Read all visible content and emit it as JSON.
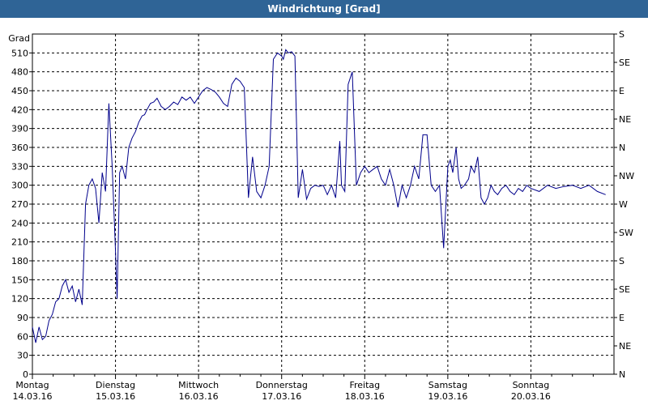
{
  "window": {
    "title": "Windrichtung [Grad]"
  },
  "chart_data": {
    "type": "line",
    "title": "Windrichtung [Grad]",
    "ylabel": "Grad",
    "ylim": [
      0,
      540
    ],
    "yticks": [
      0,
      30,
      60,
      90,
      120,
      150,
      180,
      210,
      240,
      270,
      300,
      330,
      360,
      390,
      420,
      450,
      480,
      510
    ],
    "right_axis_labels": [
      "N",
      "NE",
      "E",
      "SE",
      "S",
      "SW",
      "W",
      "NW",
      "N",
      "NE",
      "E",
      "SE",
      "S"
    ],
    "x_tick_days": [
      "Montag",
      "Dienstag",
      "Mittwoch",
      "Donnerstag",
      "Freitag",
      "Samstag",
      "Sonntag"
    ],
    "x_tick_dates": [
      "14.03.16",
      "15.03.16",
      "16.03.16",
      "17.03.16",
      "18.03.16",
      "19.03.16",
      "20.03.16"
    ],
    "grid": true,
    "line_color": "#00008b",
    "series": [
      {
        "name": "",
        "x": [
          0.0,
          0.04,
          0.08,
          0.12,
          0.16,
          0.2,
          0.24,
          0.28,
          0.32,
          0.36,
          0.4,
          0.44,
          0.48,
          0.52,
          0.56,
          0.6,
          0.64,
          0.68,
          0.72,
          0.76,
          0.8,
          0.84,
          0.88,
          0.92,
          0.96,
          1.0,
          1.02,
          1.05,
          1.08,
          1.12,
          1.16,
          1.2,
          1.24,
          1.28,
          1.32,
          1.35,
          1.38,
          1.42,
          1.46,
          1.5,
          1.55,
          1.6,
          1.65,
          1.7,
          1.75,
          1.8,
          1.85,
          1.9,
          1.95,
          2.0,
          2.05,
          2.1,
          2.15,
          2.2,
          2.25,
          2.3,
          2.35,
          2.4,
          2.45,
          2.5,
          2.55,
          2.6,
          2.65,
          2.7,
          2.75,
          2.8,
          2.85,
          2.9,
          2.95,
          3.0,
          3.02,
          3.05,
          3.08,
          3.12,
          3.16,
          3.2,
          3.25,
          3.3,
          3.35,
          3.4,
          3.45,
          3.5,
          3.55,
          3.6,
          3.65,
          3.7,
          3.72,
          3.76,
          3.8,
          3.85,
          3.9,
          3.95,
          4.0,
          4.05,
          4.1,
          4.15,
          4.2,
          4.25,
          4.3,
          4.35,
          4.4,
          4.45,
          4.5,
          4.55,
          4.6,
          4.65,
          4.7,
          4.75,
          4.8,
          4.85,
          4.9,
          4.95,
          5.0,
          5.03,
          5.06,
          5.1,
          5.13,
          5.16,
          5.2,
          5.25,
          5.28,
          5.32,
          5.36,
          5.4,
          5.44,
          5.48,
          5.52,
          5.56,
          5.6,
          5.65,
          5.7,
          5.75,
          5.8,
          5.85,
          5.9,
          5.95,
          6.0,
          6.1,
          6.2,
          6.3,
          6.4,
          6.5,
          6.6,
          6.7,
          6.8,
          6.9
        ],
        "y": [
          75,
          50,
          75,
          55,
          60,
          85,
          95,
          115,
          120,
          140,
          150,
          130,
          140,
          115,
          135,
          110,
          270,
          300,
          310,
          295,
          240,
          320,
          290,
          430,
          330,
          195,
          120,
          320,
          330,
          310,
          360,
          375,
          385,
          400,
          410,
          412,
          420,
          430,
          432,
          438,
          425,
          420,
          425,
          432,
          428,
          440,
          435,
          440,
          430,
          440,
          450,
          455,
          452,
          448,
          440,
          430,
          425,
          460,
          470,
          465,
          455,
          280,
          345,
          290,
          280,
          300,
          330,
          500,
          510,
          505,
          500,
          515,
          510,
          512,
          505,
          280,
          325,
          278,
          295,
          300,
          298,
          300,
          285,
          300,
          280,
          370,
          300,
          290,
          460,
          480,
          300,
          320,
          330,
          320,
          325,
          330,
          310,
          300,
          325,
          300,
          265,
          300,
          280,
          300,
          330,
          310,
          380,
          380,
          300,
          290,
          300,
          200,
          330,
          340,
          320,
          360,
          310,
          295,
          300,
          310,
          330,
          320,
          345,
          280,
          270,
          280,
          300,
          290,
          285,
          295,
          300,
          290,
          285,
          295,
          290,
          300,
          295,
          290,
          300,
          295,
          298,
          300,
          295,
          300,
          290,
          285
        ]
      }
    ]
  }
}
